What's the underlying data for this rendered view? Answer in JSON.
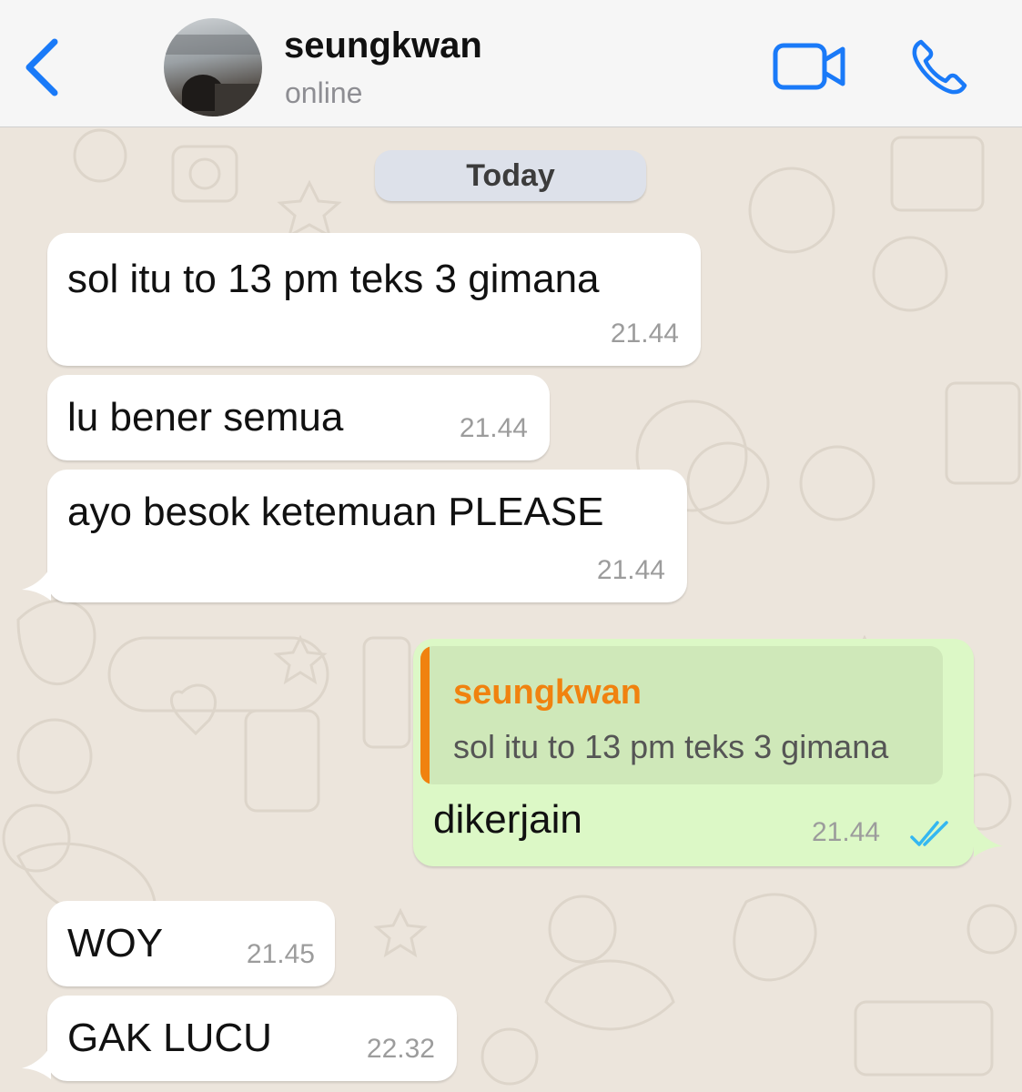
{
  "header": {
    "back_label": "",
    "contact_name": "seungkwan",
    "status": "online"
  },
  "chat": {
    "date_separator": "Today",
    "messages": [
      {
        "direction": "incoming",
        "text": "sol itu to 13 pm teks 3 gimana",
        "time": "21.44"
      },
      {
        "direction": "incoming",
        "text": "lu bener semua",
        "time": "21.44"
      },
      {
        "direction": "incoming",
        "text": "ayo besok ketemuan PLEASE",
        "time": "21.44"
      },
      {
        "direction": "outgoing",
        "reply_to": {
          "name": "seungkwan",
          "text": "sol itu to 13 pm teks 3 gimana"
        },
        "text": "dikerjain",
        "time": "21.44",
        "status": "read"
      },
      {
        "direction": "incoming",
        "text": "WOY",
        "time": "21.45"
      },
      {
        "direction": "incoming",
        "text": "GAK LUCU",
        "time": "22.32"
      }
    ]
  },
  "colors": {
    "accent": "#1a7af8",
    "incoming_bubble": "#ffffff",
    "outgoing_bubble": "#dcf8c6",
    "quote_name": "#f0820f",
    "read_ticks": "#34b7f1",
    "wallpaper": "#ece5dc"
  },
  "icons": {
    "back": "chevron-left-icon",
    "video": "video-camera-icon",
    "call": "phone-icon",
    "read_status": "double-check-icon"
  }
}
